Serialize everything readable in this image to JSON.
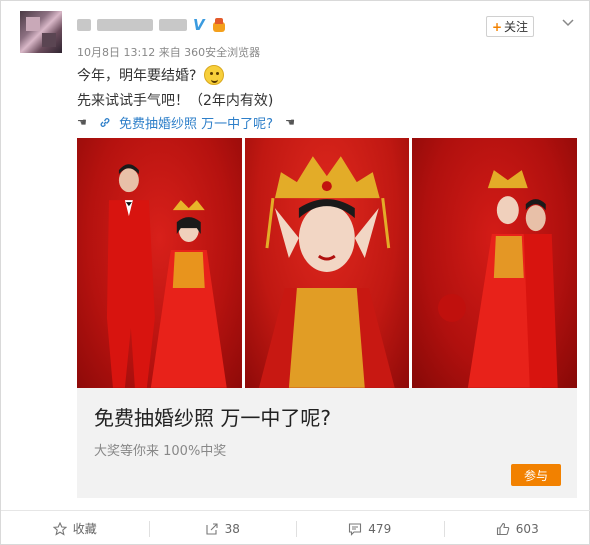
{
  "header": {
    "follow_label": "关注",
    "follow_plus": "+",
    "meta": "10月8日 13:12 来自 360安全浏览器"
  },
  "post": {
    "line1": "今年，明年要结婚?",
    "line2": "先来试试手气吧！（2年内有效)",
    "link_text": "免费抽婚纱照 万一中了呢?",
    "hand_left": "☚",
    "hand_right": "☚"
  },
  "ad": {
    "title": "免费抽婚纱照 万一中了呢?",
    "subtitle": "大奖等你来 100%中奖",
    "button": "参与"
  },
  "footer": {
    "favorite_label": "收藏",
    "repost_count": "38",
    "comment_count": "479",
    "like_count": "603"
  },
  "icons": {
    "verified": "V",
    "link": "link-icon"
  },
  "colors": {
    "accent": "#f28100",
    "link": "#2e7fc9"
  }
}
